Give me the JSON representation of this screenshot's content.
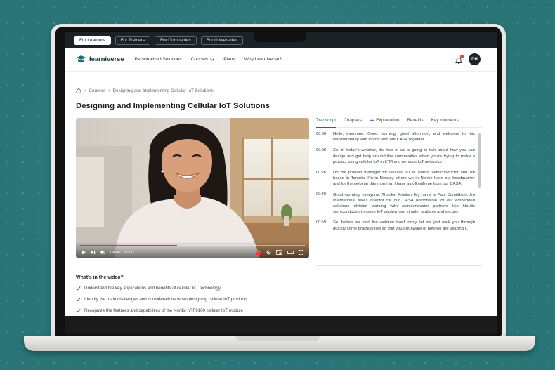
{
  "audience_tabs": [
    "For Learners",
    "For Trainers",
    "For Companies",
    "For Universities"
  ],
  "nav": {
    "logo": "learniverse",
    "items": [
      "Personalized Solutions",
      "Courses",
      "Plans",
      "Why Learniverse?"
    ],
    "notification_count": "1",
    "avatar_initials": "DH"
  },
  "breadcrumb": [
    "Courses",
    "Designing and Implementing Cellular IoT Solutions"
  ],
  "page_title": "Designing and Implementing Cellular IoT Solutions",
  "video": {
    "time": "04:45 / 11:00",
    "progress": 0.43
  },
  "tabs": [
    "Transcript",
    "Chapters",
    "Explanation",
    "Benefits",
    "Key moments"
  ],
  "transcript": [
    {
      "time": "00:00",
      "text": "Hello, everyone. Good morning, good afternoon, and welcome to this webinar today with Nordic and our CASA together."
    },
    {
      "time": "00:08",
      "text": "So, in today's webinar, the two of us is going to talk about how you can design and get help around the complexities when you're trying to make a product using cellular IoT in LTM and nervous IoT networks."
    },
    {
      "time": "00:26",
      "text": "I'm the product manager for cellular IoT in Nordic semiconductor and I'm based in Toronto, I'm in Norway where we in Nordic have our headquarter and for the webinar this morning, I have a poll with me from our CASA."
    },
    {
      "time": "00:40",
      "text": "Good morning, everyone. Thanks, Kristian. My name is Paul Donaldson. I'm international sales director for our CASA responsible for our embedded solutions division working with semiconductor partners like Nordic semiconductor to make IoT deployment simple, scalable and secure."
    },
    {
      "time": "00:59",
      "text": "So, before we start the webinar itself today, let me just walk you through quickly some practicalities so that you are aware of how we are utilizing it."
    }
  ],
  "whats_in_video": {
    "title": "What's in the video?",
    "items": [
      "Understand the key applications and benefits of cellular IoT technology",
      "Identify the main challenges and considerations when designing cellular IoT products",
      "Recognize the features and capabilities of the Nordic nRF9160 cellular IoT module"
    ]
  },
  "colors": {
    "accent": "#1d6e72",
    "progress": "#e53935",
    "background": "#2e7b7d"
  }
}
